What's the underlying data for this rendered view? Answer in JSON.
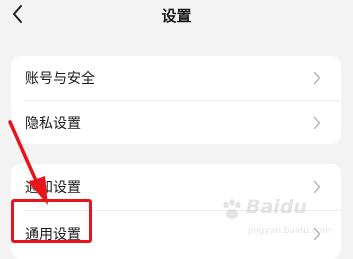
{
  "header": {
    "title": "设置"
  },
  "icons": {
    "back": "chevron-left-icon",
    "item_arrow": "chevron-right-icon"
  },
  "groups": [
    {
      "items": [
        {
          "label": "账号与安全"
        },
        {
          "label": "隐私设置"
        }
      ]
    },
    {
      "items": [
        {
          "label": "通知设置"
        },
        {
          "label": "通用设置"
        }
      ]
    }
  ],
  "annotation": {
    "highlighted_item": "通用设置",
    "color": "#e8141c"
  },
  "watermark": {
    "brand": "Baidu",
    "site": "jingyan.baidu.com"
  },
  "colors": {
    "background": "#f3f3f3",
    "card": "#ffffff",
    "accent_annotation": "#e8141c"
  }
}
